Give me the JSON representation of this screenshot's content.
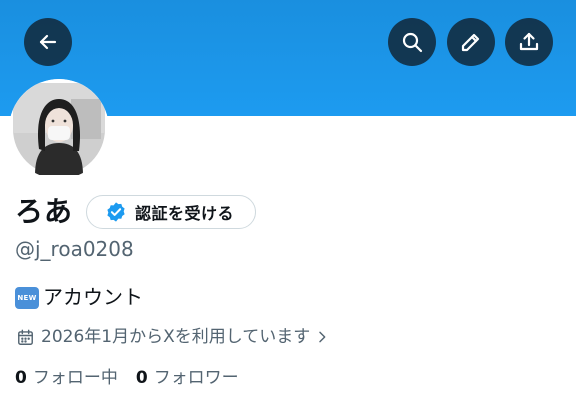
{
  "header": {
    "back_icon": "arrow-left-icon",
    "search_icon": "search-icon",
    "edit_icon": "pencil-icon",
    "share_icon": "share-upload-icon",
    "banner_color": "#1d9bf0"
  },
  "profile": {
    "display_name": "ろあ",
    "verify_button_label": "認証を受ける",
    "verify_icon": "verified-badge-icon",
    "verify_color": "#1d9bf0",
    "handle": "@j_roa0208",
    "bio_badge": "NEW",
    "bio_text": "アカウント",
    "joined_text": "2026年1月からXを利用しています",
    "joined_icon": "calendar-icon"
  },
  "stats": {
    "following_count": "0",
    "following_label": "フォロー中",
    "followers_count": "0",
    "followers_label": "フォロワー"
  }
}
